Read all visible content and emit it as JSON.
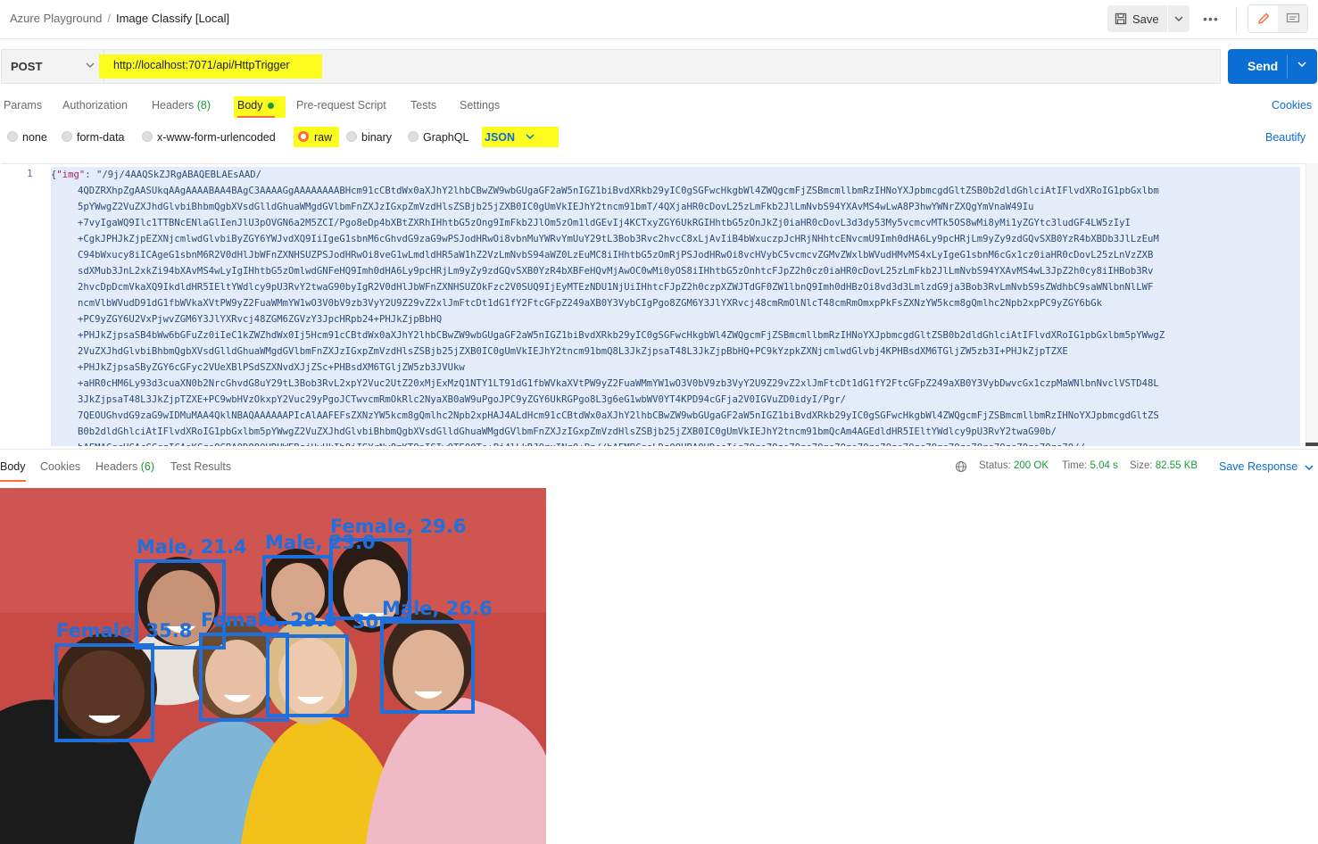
{
  "breadcrumb": {
    "workspace": "Azure Playground",
    "separator": "/",
    "request": "Image Classify [Local]"
  },
  "toolbar": {
    "save_label": "Save",
    "more_label": "•••"
  },
  "request": {
    "method": "POST",
    "url": "http://localhost:7071/api/HttpTrigger",
    "send_label": "Send"
  },
  "tabs": {
    "params": "Params",
    "authorization": "Authorization",
    "headers": "Headers",
    "headers_count": "(8)",
    "body": "Body",
    "prerequest": "Pre-request Script",
    "tests": "Tests",
    "settings": "Settings",
    "cookies": "Cookies"
  },
  "body_types": {
    "none": "none",
    "form_data": "form-data",
    "urlencoded": "x-www-form-urlencoded",
    "raw": "raw",
    "binary": "binary",
    "graphql": "GraphQL",
    "format": "JSON",
    "beautify": "Beautify"
  },
  "editor": {
    "line_number": "1",
    "key": "\"img\"",
    "first_value": "\"/9j/4AAQSkZJRgABAQEBLAEsAAD/",
    "lines": [
      "4QDZRXhpZgAASUkqAAgAAAABAA4BAgC3AAAAGgAAAAAAAABHcm91cCBtdWx0aXJhY2lhbCBwZW9wbGUgaGF2aW5nIGZ1biBvdXRkb29yIC0gSGFwcHkgbWl4ZWQgcmFjZSBmcmllbmRzIHNoYXJpbmcgdGltZSB0b2dldGhlciAtIFlvdXRoIG1pbGxlbm",
      "5pYWwgZ2VuZXJhdGlvbiBhbmQgbXVsdGlldGhuaWMgdGVlbmFnZXJzIGxpZmVzdHlsZSBjb25jZXB0IC0gUmVkIEJhY2tncm91bmT/4QXjaHR0cDovL25zLmFkb2JlLmNvbS94YXAvMS4wLwA8P3hwYWNrZXQgYmVnaW49Iu",
      "+7vyIgaWQ9Ilc1TTBNcENlaGlIenJlU3pOVGN6a2M5ZCI/Pgo8eDp4bXBtZXRhIHhtbG5zOng9ImFkb2JlOm5zOm1ldGEvIj4KCTxyZGY6UkRGIHhtbG5zOnJkZj0iaHR0cDovL3d3dy53My5vcmcvMTk5OS8wMi8yMi1yZGYtc3ludGF4LW5zIyI",
      "+CgkJPHJkZjpEZXNjcmlwdGlvbiByZGY6YWJvdXQ9IiIgeG1sbnM6cGhvdG9zaG9wPSJodHRwOi8vbnMuYWRvYmUuY29tL3Bob3Rvc2hvcC8xLjAvIiB4bWxuczpJcHRjNHhtcENvcmU9Imh0dHA6Ly9pcHRjLm9yZy9zdGQvSXB0YzR4bXBDb3JlLzEuM",
      "C94bWxucy8iICAgeG1sbnM6R2V0dHlJbWFnZXNHSUZPSJodHRwOi8veG1wLmdldHR5aW1hZ2VzLmNvbS94aWZ0LzEuMC8iIHhtbG5zOmRjPSJodHRwOi8vcHVybC5vcmcvZGMvZWxlbWVudHMvMS4xLyIgeG1sbnM6cGx1cz0iaHR0cDovL25zLnVzZXB",
      "sdXMub3JnL2xkZi94bXAvMS4wLyIgIHhtbG5zOmlwdGNFeHQ9Imh0dHA6Ly9pcHRjLm9yZy9zdGQvSXB0YzR4bXBFeHQvMjAwOC0wMi0yOS8iIHhtbG5zOnhtcFJpZ2h0cz0iaHR0cDovL25zLmFkb2JlLmNvbS94YXAvMS4wL3JpZ2h0cy8iIHBob3Rv",
      "2hvcDpDcmVkaXQ9IkdldHR5IEltYWdlcy9pU3RvY2twaG90byIgR2V0dHlJbWFnZXNHSUZOkFzc2V0SUQ9IjEyMTEzNDU1NjUiIHhtcFJpZ2h0czpXZWJTdGF0ZW1lbnQ9Imh0dHBzOi8vd3d3LmlzdG9ja3Bob3RvLmNvbS9sZWdhbC9saWNlbnNlLWF",
      "ncmVlbWVudD91dG1fbWVkaXVtPW9yZ2FuaWMmYW1wO3V0bV9zb3VyY2U9Z29vZ2xlJmFtcDt1dG1fY2FtcGFpZ249aXB0Y3VybCIgPgo8ZGM6Y3JlYXRvcj48cmRmOlNlcT48cmRmOmxpPkFsZXNzYW5kcm8gQmlhc2Npb2xpPC9yZGY6bGk",
      "+PC9yZGY6U2VxPjwvZGM6Y3JlYXRvcj48ZGM6ZGVzY3JpcHRpb24+PHJkZjpBbHQ",
      "+PHJkZjpsaSB4bWw6bGFuZz0iIeC1kZWZhdWx0Ij5Hcm91cCBtdWx0aXJhY2lhbCBwZW9wbGUgaGF2aW5nIGZ1biBvdXRkb29yIC0gSGFwcHkgbWl4ZWQgcmFjZSBmcmllbmRzIHNoYXJpbmcgdGltZSB0b2dldGhlciAtIFlvdXRoIG1pbGxlbm5pYWwgZ",
      "2VuZXJhdGlvbiBhbmQgbXVsdGlldGhuaWMgdGVlbmFnZXJzIGxpZmVzdHlsZSBjb25jZXB0IC0gUmVkIEJhY2tncm91bmQ8L3JkZjpsaT48L3JkZjpBbHQ+PC9kYzpkZXNjcmlwdGlvbj4KPHBsdXM6TGljZW5zb3I+PHJkZjpTZXE",
      "+PHJkZjpsaSByZGY6cGFyc2VUeXBlPSdSZXNvdXJjZSc+PHBsdXM6TGljZW5zb3JVUkw",
      "+aHR0cHM6Ly93d3cuaXN0b2NrcGhvdG8uY29tL3Bob3RvL2xpY2Vuc2UtZ20xMjExMzQ1NTY1LT91dG1fbWVkaXVtPW9yZ2FuaWMmYW1wO3V0bV9zb3VyY2U9Z29vZ2xlJmFtcDt1dG1fY2FtcGFpZ249aXB0Y3VybDwvcGx1czpMaWNlbnNvclVSTD48L",
      "3JkZjpsaT48L3JkZjpTZXE+PC9wbHVzOkxpY2Vuc29yPgoJCTwvcmRmOkRlc2NyaXB0aW9uPgoJPC9yZGY6UkRGPgo8L3g6eG1wbWV0YT4KPD94cGFja2V0IGVuZD0idyI/Pgr/",
      "7QEOUGhvdG9zaG9wIDMuMAA4QklNBAQAAAAAAPIcAlAAFEFsZXNzYW5kcm8gQmlhc2Npb2xpHAJ4ALdHcm91cCBtdWx0aXJhY2lhbCBwZW9wbGUgaGF2aW5nIGZ1biBvdXRkb29yIC0gSGFwcHkgbWl4ZWQgcmFjZSBmcmllbmRzIHNoYXJpbmcgdGltZS",
      "B0b2dldGhlciAtIFlvdXRoIG1pbGxlbm5pYWwgZ2VuZXJhdGlvbiBhbmQgbXVsdGlldGhuaWMgdGVlbmFnZXJzIGxpZmVzdHlsZSBjb25jZXB0IC0gUmVkIEJhY2tncm91bmQcAm4AGEdldHR5IEltYWdlcy9pU3RvY2twaG90b/",
      "bAEMACgcHCAcGCgqICAsKCgsOGBAODQ0OHRUWERgjHyUkIh8iISYrNy8mKTQpISIwQTE0OTs+Pj4lLkRJQzxINz0+Pz//bAEMBCgsLDg0OHBAQHDsoIig7Ozs7Ozs7Ozs7Ozs7Ozs7Ozs7Ozs7Ozs7Ozs7Ozs7Ozs7Ozs7Ozs7Ozs7O//"
    ]
  },
  "response": {
    "tabs": {
      "body": "Body",
      "cookies": "Cookies",
      "headers": "Headers",
      "headers_count": "(6)",
      "test_results": "Test Results"
    },
    "status_label": "Status:",
    "status_value": "200 OK",
    "time_label": "Time:",
    "time_value": "5.04 s",
    "size_label": "Size:",
    "size_value": "82.55 KB",
    "save_label": "Save Response"
  },
  "detections": [
    {
      "label": "Male, 21.4"
    },
    {
      "label": "Male, 23.0"
    },
    {
      "label": "Female, 29.6"
    },
    {
      "label": "Female, 35.8"
    },
    {
      "label": "Female, 29.6"
    },
    {
      "label": "30"
    },
    {
      "label": "Male, 26.6"
    }
  ],
  "colors": {
    "accent": "#0b6ed5",
    "highlight": "#fcfc1e",
    "orange": "#ff6c37",
    "success": "#1a9a3a",
    "box": "#1f6fdd",
    "background": "#c74a45"
  }
}
